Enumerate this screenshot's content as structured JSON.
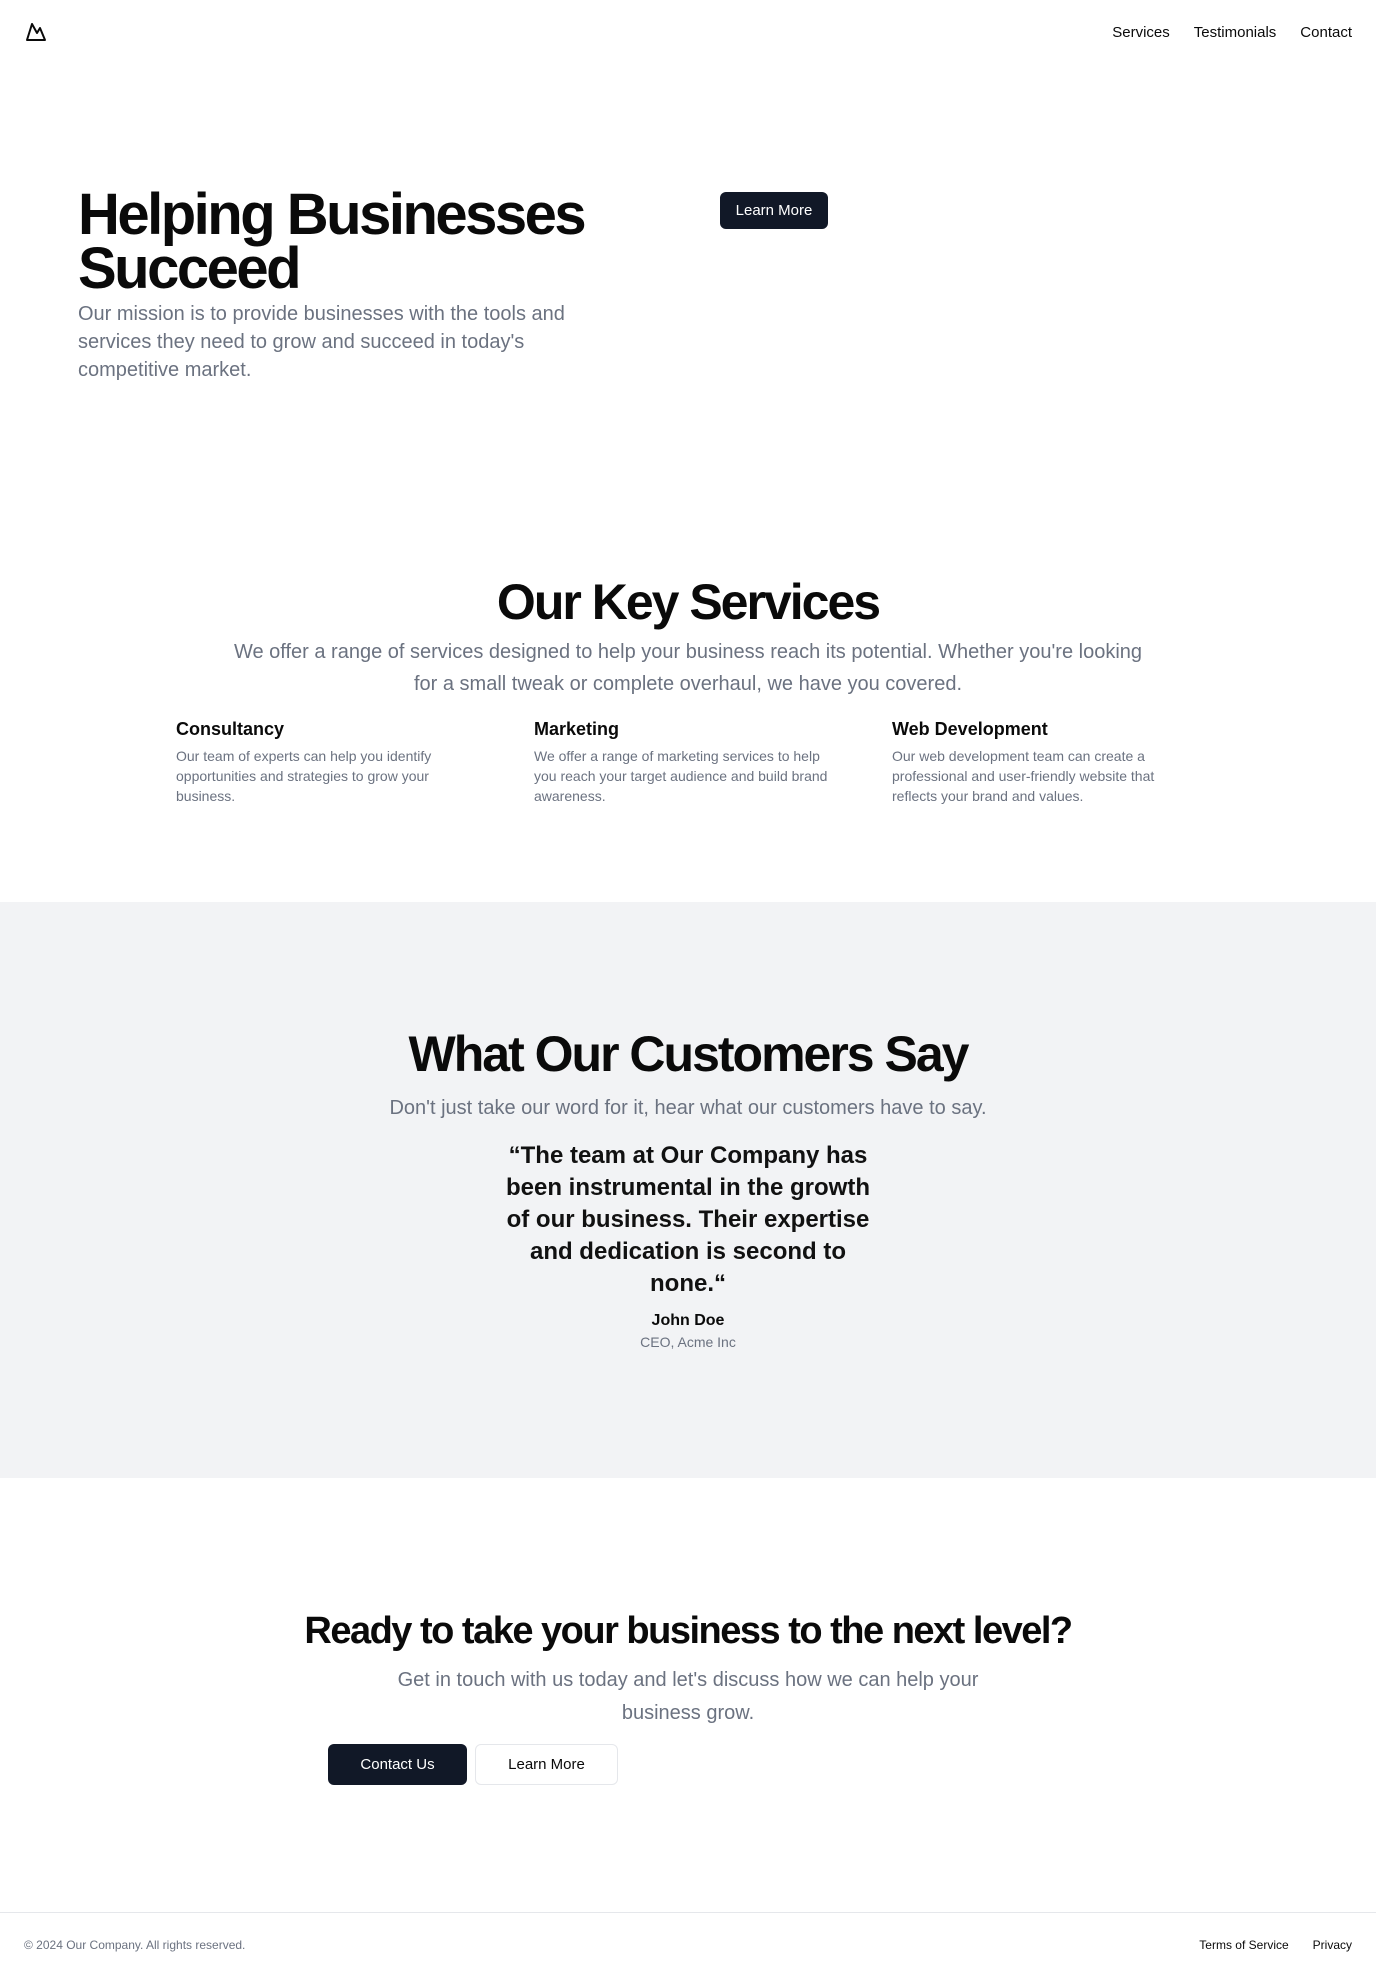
{
  "header": {
    "logo_icon": "mountain-icon",
    "nav": [
      {
        "label": "Services"
      },
      {
        "label": "Testimonials"
      },
      {
        "label": "Contact"
      }
    ]
  },
  "hero": {
    "title": "Helping Businesses Succeed",
    "text": "Our mission is to provide businesses with the tools and services they need to grow and succeed in today's competitive market.",
    "button_label": "Learn More"
  },
  "services": {
    "title": "Our Key Services",
    "subtitle": "We offer a range of services designed to help your business reach its potential. Whether you're looking for a small tweak or complete overhaul, we have you covered.",
    "items": [
      {
        "title": "Consultancy",
        "text": "Our team of experts can help you identify opportunities and strategies to grow your business."
      },
      {
        "title": "Marketing",
        "text": "We offer a range of marketing services to help you reach your target audience and build brand awareness."
      },
      {
        "title": "Web Development",
        "text": "Our web development team can create a professional and user-friendly website that reflects your brand and values."
      }
    ]
  },
  "testimonials": {
    "title": "What Our Customers Say",
    "subtitle": "Don't just take our word for it, hear what our customers have to say.",
    "quote": "“The team at Our Company has been instrumental in the growth of our business. Their expertise and dedication is second to none.“",
    "author": "John Doe",
    "role": "CEO, Acme Inc"
  },
  "cta": {
    "title": "Ready to take your business to the next level?",
    "text": "Get in touch with us today and let's discuss how we can help your business grow.",
    "contact_label": "Contact Us",
    "learn_label": "Learn More"
  },
  "footer": {
    "copyright": "© 2024 Our Company. All rights reserved.",
    "links": [
      {
        "label": "Terms of Service"
      },
      {
        "label": "Privacy"
      }
    ]
  },
  "colors": {
    "primary_button": "#111827",
    "muted_text": "#6b7280",
    "testimonials_bg": "#f2f3f5"
  }
}
